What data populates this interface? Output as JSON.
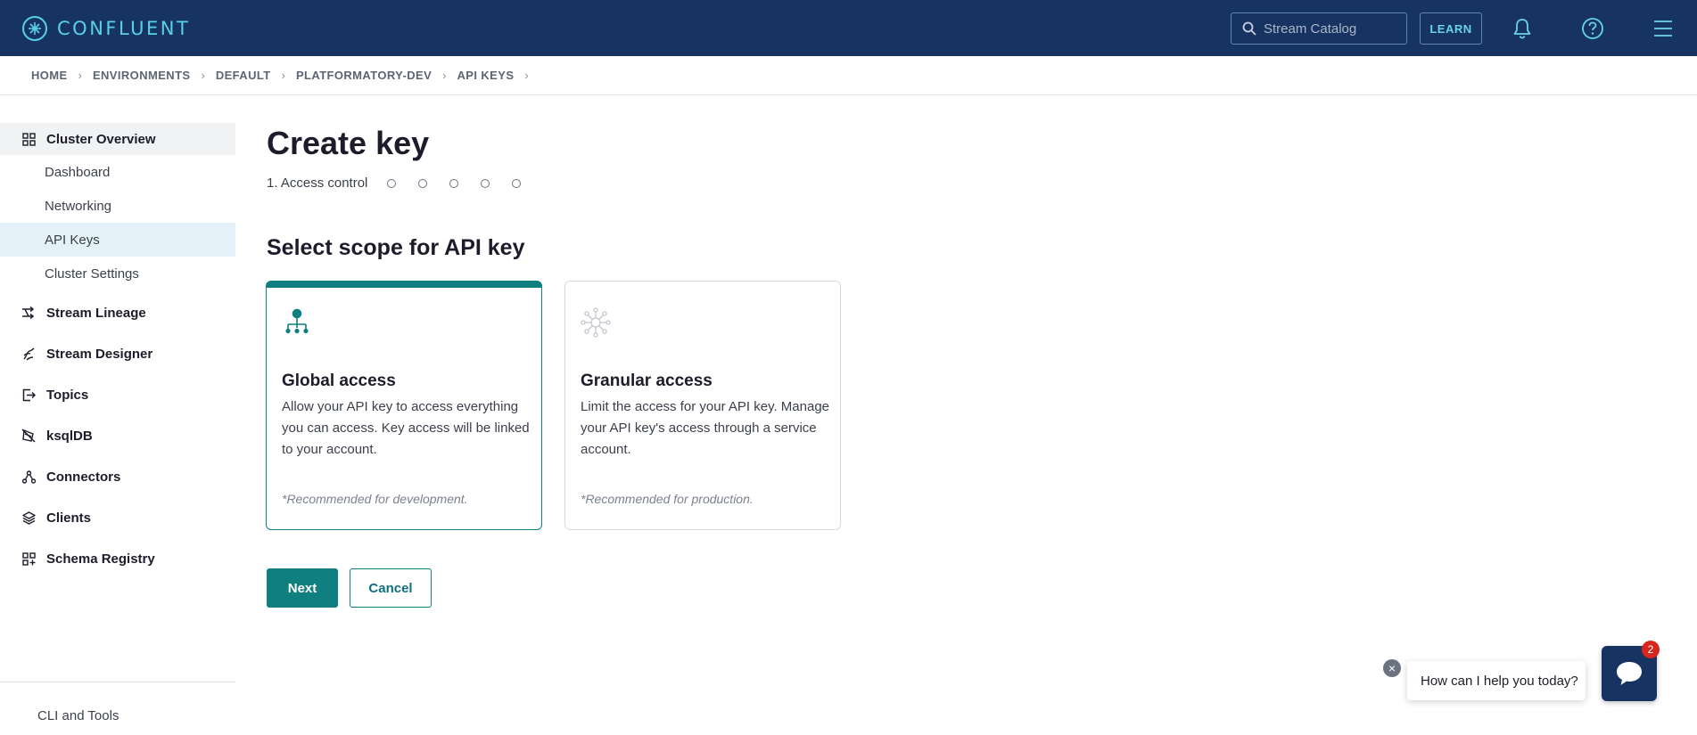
{
  "app": {
    "brand": "CONFLUENT",
    "search_placeholder": "Stream Catalog",
    "learn_label": "LEARN",
    "icons": [
      "confluent-logo-icon",
      "search-icon",
      "bell-icon",
      "help-icon",
      "hamburger-menu-icon"
    ]
  },
  "breadcrumb": [
    "HOME",
    "ENVIRONMENTS",
    "DEFAULT",
    "PLATFORMATORY-DEV",
    "API KEYS"
  ],
  "sidebar": {
    "cluster_overview": "Cluster Overview",
    "sub_items": [
      "Dashboard",
      "Networking",
      "API Keys",
      "Cluster Settings"
    ],
    "selected_sub": "API Keys",
    "items": [
      "Stream Lineage",
      "Stream Designer",
      "Topics",
      "ksqlDB",
      "Connectors",
      "Clients",
      "Schema Registry"
    ],
    "footer_link": "CLI and Tools"
  },
  "main": {
    "title": "Create key",
    "step_label": "1. Access control",
    "section_title": "Select scope for API key",
    "cards": [
      {
        "title": "Global access",
        "description": "Allow your API key to access everything you can access. Key access will be linked to your account.",
        "note": "*Recommended for development.",
        "selected": true
      },
      {
        "title": "Granular access",
        "description": "Limit the access for your API key. Manage your API key's access through a service account.",
        "note": "*Recommended for production.",
        "selected": false
      }
    ],
    "next_label": "Next",
    "cancel_label": "Cancel"
  },
  "chat": {
    "prompt": "How can I help you today?",
    "badge_count": "2"
  },
  "colors": {
    "topbar": "#173361",
    "accent": "#0f7f80",
    "brand_text": "#5ad0e6"
  }
}
